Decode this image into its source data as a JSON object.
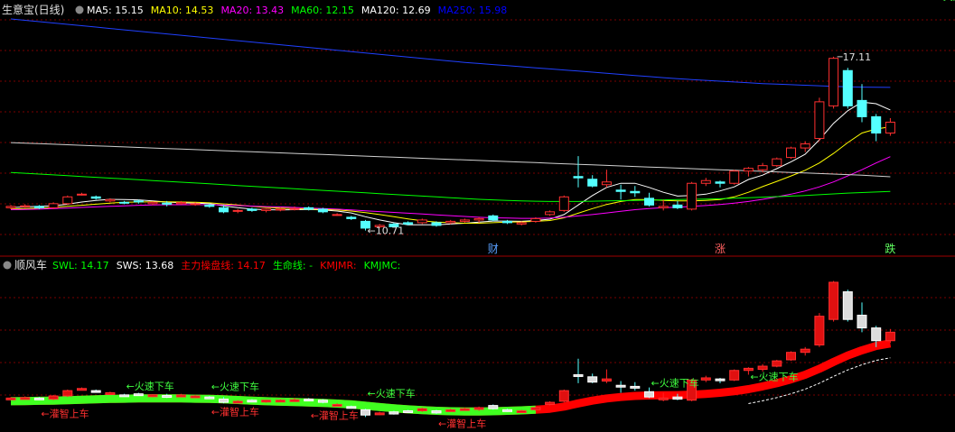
{
  "top_panel": {
    "title": "生意宝(日线)",
    "ma_labels": [
      {
        "text": "MA5: 15.15",
        "color": "#ffffff"
      },
      {
        "text": "MA10: 14.53",
        "color": "#ffff00"
      },
      {
        "text": "MA20: 13.43",
        "color": "#ff00ff"
      },
      {
        "text": "MA60: 12.15",
        "color": "#00ff00"
      },
      {
        "text": "MA120: 12.69",
        "color": "#ffffff"
      },
      {
        "text": "MA250: 15.98",
        "color": "#0000ff"
      }
    ],
    "high_label": "17.11",
    "low_label": "←10.71",
    "markers": [
      {
        "text": "财",
        "color": "#5aa0ff",
        "bar": 34
      },
      {
        "text": "涨",
        "color": "#ff6060",
        "bar": 50
      },
      {
        "text": "跌",
        "color": "#60ff60",
        "bar": 62
      }
    ]
  },
  "bottom_panel": {
    "title": "顺风车",
    "labels": [
      {
        "text": "SWL: 14.17",
        "color": "#00ff00"
      },
      {
        "text": "SWS: 13.68",
        "color": "#ffffff"
      },
      {
        "text": "主力操盘线: 14.17",
        "color": "#ff0000"
      },
      {
        "text": "生命线: -",
        "color": "#00ff00"
      },
      {
        "text": "KMJMR:",
        "color": "#ff0000"
      },
      {
        "text": "KMJMC:",
        "color": "#00ff00"
      }
    ],
    "signals": [
      {
        "text": "←灌智上车",
        "color": "#ff3030",
        "bar": 2,
        "pos": "below"
      },
      {
        "text": "←火速下车",
        "color": "#40ff40",
        "bar": 8,
        "pos": "above"
      },
      {
        "text": "←火速下车",
        "color": "#40ff40",
        "bar": 14,
        "pos": "above"
      },
      {
        "text": "←灌智上车",
        "color": "#ff3030",
        "bar": 14,
        "pos": "below"
      },
      {
        "text": "←火速下车",
        "color": "#40ff40",
        "bar": 25,
        "pos": "above"
      },
      {
        "text": "←灌智上车",
        "color": "#ff3030",
        "bar": 21,
        "pos": "below"
      },
      {
        "text": "←灌智上车",
        "color": "#ff3030",
        "bar": 30,
        "pos": "below"
      },
      {
        "text": "←火速下车",
        "color": "#40ff40",
        "bar": 45,
        "pos": "above"
      },
      {
        "text": "←火速下车",
        "color": "#40ff40",
        "bar": 52,
        "pos": "above"
      },
      {
        "text": "←火速下车",
        "color": "#40ff40",
        "bar": 65,
        "pos": "above"
      }
    ]
  },
  "chart_data": {
    "type": "candlestick",
    "title": "生意宝(日线)",
    "ylim": [
      10.3,
      18.6
    ],
    "candles": [
      [
        11.55,
        11.65,
        11.5,
        11.6
      ],
      [
        11.6,
        11.68,
        11.55,
        11.62
      ],
      [
        11.6,
        11.65,
        11.5,
        11.55
      ],
      [
        11.55,
        11.75,
        11.5,
        11.7
      ],
      [
        11.7,
        12.0,
        11.65,
        11.95
      ],
      [
        12.05,
        12.1,
        12.0,
        12.05
      ],
      [
        11.95,
        12.0,
        11.85,
        11.9
      ],
      [
        11.8,
        11.9,
        11.75,
        11.85
      ],
      [
        11.75,
        11.8,
        11.68,
        11.72
      ],
      [
        11.8,
        11.85,
        11.7,
        11.78
      ],
      [
        11.7,
        11.78,
        11.65,
        11.75
      ],
      [
        11.72,
        11.8,
        11.6,
        11.68
      ],
      [
        11.7,
        11.8,
        11.66,
        11.74
      ],
      [
        11.68,
        11.75,
        11.62,
        11.7
      ],
      [
        11.65,
        11.7,
        11.55,
        11.6
      ],
      [
        11.55,
        11.65,
        11.35,
        11.4
      ],
      [
        11.45,
        11.5,
        11.35,
        11.45
      ],
      [
        11.5,
        11.55,
        11.4,
        11.45
      ],
      [
        11.45,
        11.52,
        11.38,
        11.5
      ],
      [
        11.48,
        11.55,
        11.42,
        11.5
      ],
      [
        11.5,
        11.6,
        11.45,
        11.52
      ],
      [
        11.55,
        11.6,
        11.45,
        11.5
      ],
      [
        11.5,
        11.55,
        11.35,
        11.4
      ],
      [
        11.3,
        11.35,
        11.25,
        11.3
      ],
      [
        11.2,
        11.25,
        11.1,
        11.15
      ],
      [
        11.05,
        11.1,
        10.71,
        10.8
      ],
      [
        10.85,
        10.95,
        10.8,
        10.9
      ],
      [
        10.95,
        11.0,
        10.82,
        10.85
      ],
      [
        11.0,
        11.05,
        10.9,
        10.95
      ],
      [
        11.0,
        11.15,
        10.95,
        11.1
      ],
      [
        11.0,
        11.05,
        10.85,
        10.9
      ],
      [
        11.0,
        11.1,
        10.95,
        11.05
      ],
      [
        11.05,
        11.15,
        11.0,
        11.1
      ],
      [
        11.1,
        11.2,
        11.0,
        11.15
      ],
      [
        11.25,
        11.3,
        11.05,
        11.1
      ],
      [
        11.05,
        11.1,
        10.95,
        11.0
      ],
      [
        10.95,
        11.05,
        10.9,
        11.0
      ],
      [
        11.05,
        11.2,
        11.0,
        11.15
      ],
      [
        11.3,
        11.45,
        11.25,
        11.4
      ],
      [
        11.45,
        12.0,
        11.4,
        11.95
      ],
      [
        12.7,
        13.45,
        12.3,
        12.65
      ],
      [
        12.6,
        12.75,
        12.3,
        12.35
      ],
      [
        12.4,
        12.95,
        12.3,
        12.5
      ],
      [
        12.2,
        12.4,
        11.85,
        12.15
      ],
      [
        12.15,
        12.35,
        11.95,
        12.1
      ],
      [
        11.9,
        12.1,
        11.6,
        11.65
      ],
      [
        11.55,
        11.85,
        11.45,
        11.6
      ],
      [
        11.65,
        11.8,
        11.5,
        11.55
      ],
      [
        11.5,
        12.5,
        11.45,
        12.45
      ],
      [
        12.45,
        12.65,
        12.35,
        12.55
      ],
      [
        12.5,
        12.55,
        12.3,
        12.45
      ],
      [
        12.45,
        12.95,
        12.4,
        12.9
      ],
      [
        12.9,
        13.05,
        12.7,
        13.0
      ],
      [
        12.95,
        13.2,
        12.85,
        13.1
      ],
      [
        13.1,
        13.4,
        13.05,
        13.35
      ],
      [
        13.4,
        13.8,
        13.35,
        13.75
      ],
      [
        13.75,
        14.0,
        13.6,
        13.9
      ],
      [
        14.1,
        15.6,
        14.0,
        15.45
      ],
      [
        15.3,
        17.11,
        15.2,
        17.05
      ],
      [
        16.6,
        16.7,
        15.2,
        15.3
      ],
      [
        15.5,
        16.1,
        14.7,
        14.9
      ],
      [
        14.9,
        15.0,
        14.0,
        14.3
      ],
      [
        14.3,
        14.85,
        14.2,
        14.7
      ]
    ],
    "ma_series": [
      {
        "name": "MA5",
        "color": "#ffffff",
        "values": [
          11.55,
          11.58,
          11.6,
          11.62,
          11.68,
          11.76,
          11.82,
          11.86,
          11.85,
          11.84,
          11.8,
          11.76,
          11.73,
          11.72,
          11.7,
          11.62,
          11.55,
          11.5,
          11.48,
          11.47,
          11.48,
          11.49,
          11.47,
          11.43,
          11.36,
          11.22,
          11.1,
          11.0,
          10.92,
          10.92,
          10.92,
          10.95,
          10.98,
          11.02,
          11.06,
          11.06,
          11.05,
          11.08,
          11.13,
          11.3,
          11.65,
          12.0,
          12.3,
          12.45,
          12.45,
          12.3,
          12.12,
          11.98,
          12.0,
          12.05,
          12.17,
          12.32,
          12.59,
          12.75,
          12.99,
          13.24,
          13.52,
          14.05,
          14.66,
          15.12,
          15.44,
          15.38,
          15.15
        ]
      },
      {
        "name": "MA10",
        "color": "#ffff00",
        "values": [
          11.5,
          11.52,
          11.54,
          11.56,
          11.6,
          11.64,
          11.68,
          11.72,
          11.75,
          11.76,
          11.77,
          11.77,
          11.76,
          11.75,
          11.73,
          11.69,
          11.65,
          11.6,
          11.56,
          11.54,
          11.52,
          11.5,
          11.49,
          11.47,
          11.43,
          11.37,
          11.3,
          11.22,
          11.14,
          11.07,
          11.02,
          11.0,
          10.98,
          10.98,
          11.0,
          11.02,
          11.03,
          11.05,
          11.08,
          11.18,
          11.35,
          11.52,
          11.67,
          11.78,
          11.85,
          11.85,
          11.82,
          11.8,
          11.8,
          11.82,
          11.85,
          11.95,
          12.12,
          12.33,
          12.52,
          12.72,
          12.93,
          13.2,
          13.55,
          13.95,
          14.3,
          14.45,
          14.53
        ]
      },
      {
        "name": "MA20",
        "color": "#ff00ff",
        "values": [
          11.48,
          11.49,
          11.5,
          11.52,
          11.54,
          11.56,
          11.58,
          11.6,
          11.62,
          11.64,
          11.65,
          11.66,
          11.66,
          11.66,
          11.66,
          11.65,
          11.63,
          11.61,
          11.59,
          11.58,
          11.56,
          11.54,
          11.52,
          11.5,
          11.47,
          11.44,
          11.41,
          11.38,
          11.35,
          11.32,
          11.29,
          11.26,
          11.23,
          11.2,
          11.18,
          11.17,
          11.16,
          11.16,
          11.17,
          11.2,
          11.25,
          11.3,
          11.36,
          11.42,
          11.48,
          11.52,
          11.55,
          11.57,
          11.6,
          11.63,
          11.67,
          11.72,
          11.78,
          11.86,
          11.95,
          12.05,
          12.17,
          12.32,
          12.5,
          12.72,
          12.95,
          13.2,
          13.43
        ]
      },
      {
        "name": "MA60",
        "color": "#00ff00",
        "values": [
          12.85,
          12.82,
          12.79,
          12.76,
          12.73,
          12.7,
          12.67,
          12.64,
          12.61,
          12.58,
          12.55,
          12.52,
          12.49,
          12.46,
          12.43,
          12.4,
          12.37,
          12.34,
          12.31,
          12.28,
          12.25,
          12.22,
          12.19,
          12.16,
          12.13,
          12.1,
          12.07,
          12.04,
          12.01,
          11.98,
          11.95,
          11.92,
          11.89,
          11.86,
          11.84,
          11.82,
          11.8,
          11.79,
          11.78,
          11.78,
          11.78,
          11.79,
          11.8,
          11.81,
          11.82,
          11.83,
          11.84,
          11.85,
          11.86,
          11.87,
          11.88,
          11.9,
          11.92,
          11.94,
          11.96,
          11.98,
          12.0,
          12.03,
          12.06,
          12.09,
          12.11,
          12.13,
          12.15
        ]
      },
      {
        "name": "MA120",
        "color": "#d0d0d0",
        "values": [
          13.95,
          13.93,
          13.91,
          13.89,
          13.87,
          13.85,
          13.83,
          13.81,
          13.79,
          13.77,
          13.75,
          13.73,
          13.71,
          13.69,
          13.67,
          13.65,
          13.63,
          13.61,
          13.59,
          13.57,
          13.55,
          13.53,
          13.51,
          13.49,
          13.47,
          13.45,
          13.43,
          13.41,
          13.39,
          13.37,
          13.35,
          13.33,
          13.31,
          13.29,
          13.27,
          13.25,
          13.23,
          13.21,
          13.19,
          13.17,
          13.15,
          13.13,
          13.11,
          13.09,
          13.07,
          13.05,
          13.03,
          13.01,
          12.99,
          12.97,
          12.95,
          12.93,
          12.91,
          12.89,
          12.87,
          12.85,
          12.83,
          12.81,
          12.79,
          12.77,
          12.75,
          12.72,
          12.69
        ]
      },
      {
        "name": "MA250",
        "color": "#2040ff",
        "values": [
          18.5,
          18.45,
          18.4,
          18.35,
          18.3,
          18.25,
          18.2,
          18.15,
          18.1,
          18.05,
          18.0,
          17.95,
          17.9,
          17.85,
          17.8,
          17.75,
          17.7,
          17.65,
          17.6,
          17.55,
          17.5,
          17.45,
          17.4,
          17.35,
          17.3,
          17.25,
          17.2,
          17.15,
          17.1,
          17.05,
          17.0,
          16.95,
          16.9,
          16.86,
          16.82,
          16.78,
          16.74,
          16.7,
          16.66,
          16.62,
          16.58,
          16.54,
          16.5,
          16.46,
          16.42,
          16.38,
          16.34,
          16.3,
          16.27,
          16.24,
          16.21,
          16.18,
          16.15,
          16.12,
          16.1,
          16.08,
          16.06,
          16.04,
          16.02,
          16.0,
          15.99,
          15.985,
          15.98
        ]
      }
    ],
    "lower_line": {
      "name": "主力操盘线",
      "color": "#ff0000",
      "values": [
        11.45,
        11.46,
        11.47,
        11.48,
        11.5,
        11.52,
        11.54,
        11.56,
        11.57,
        11.58,
        11.58,
        11.58,
        11.58,
        11.57,
        11.56,
        11.54,
        11.51,
        11.48,
        11.45,
        11.43,
        11.41,
        11.39,
        11.37,
        11.34,
        11.3,
        11.24,
        11.18,
        11.12,
        11.07,
        11.03,
        11.0,
        10.98,
        10.97,
        10.97,
        10.98,
        11.0,
        11.02,
        11.05,
        11.1,
        11.2,
        11.35,
        11.48,
        11.58,
        11.65,
        11.7,
        11.72,
        11.73,
        11.74,
        11.76,
        11.8,
        11.85,
        11.92,
        12.02,
        12.15,
        12.3,
        12.48,
        12.7,
        12.98,
        13.3,
        13.6,
        13.85,
        14.05,
        14.17
      ]
    }
  }
}
